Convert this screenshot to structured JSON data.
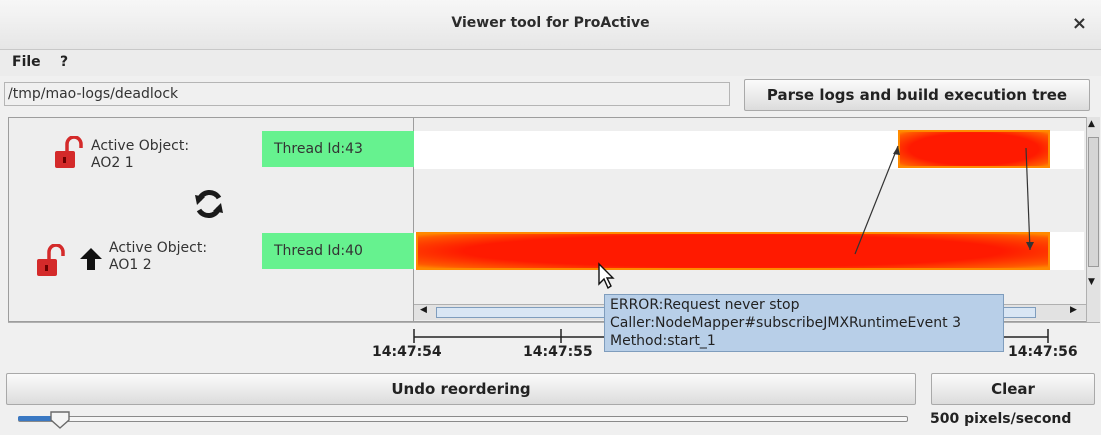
{
  "window": {
    "title": "Viewer tool for ProActive",
    "close_glyph": "×"
  },
  "menu": {
    "file": "File",
    "help": "?"
  },
  "path_input": {
    "value": "/tmp/mao-logs/deadlock"
  },
  "parse_button": {
    "label": "Parse logs and build execution tree"
  },
  "active_objects": [
    {
      "line1": "Active Object:",
      "line2": "AO2 1",
      "thread": "Thread Id:43"
    },
    {
      "line1": "Active Object:",
      "line2": "AO1 2",
      "thread": "Thread Id:40"
    }
  ],
  "icons": {
    "lock": "lock-open-icon",
    "sync": "sync-icon",
    "arrow": "arrow-up-icon"
  },
  "timeline": {
    "ticks": [
      "14:47:54",
      "14:47:55",
      "14:47:56"
    ],
    "colors": {
      "bar": "#ff1a00",
      "bar_edge": "#ffaa00",
      "thread": "#66f28f"
    }
  },
  "tooltip": {
    "line1": "ERROR:Request never stop",
    "line2": "Caller:NodeMapper#subscribeJMXRuntimeEvent 3",
    "line3": "Method:start_1"
  },
  "undo_button": {
    "label": "Undo reordering"
  },
  "clear_button": {
    "label": "Clear"
  },
  "speed": {
    "label": "500 pixels/second",
    "slider_fraction": 0.05
  }
}
